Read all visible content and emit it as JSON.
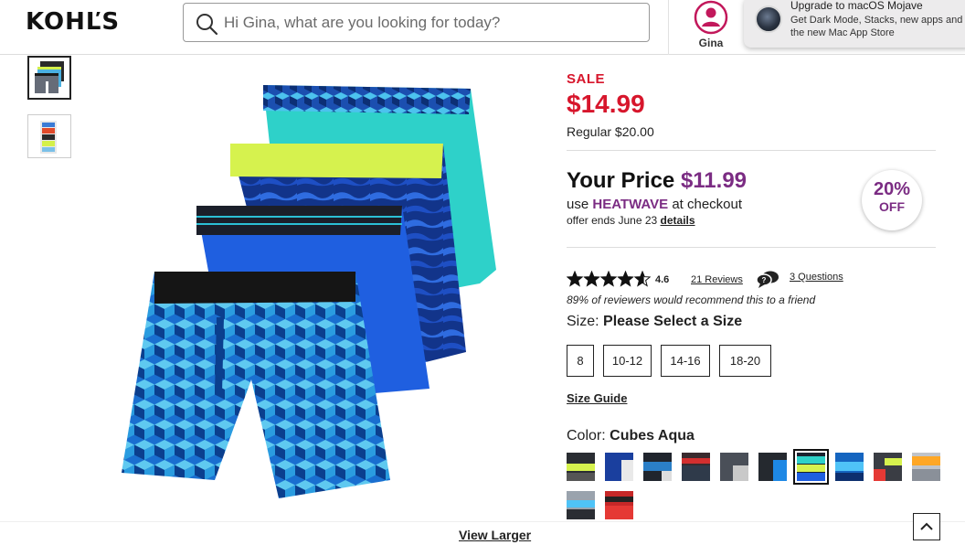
{
  "header": {
    "logo": "KOHĽS",
    "search_placeholder": "Hi Gina, what are you looking for today?",
    "account_name": "Gina"
  },
  "notification": {
    "title": "Upgrade to macOS Mojave",
    "body": "Get Dark Mode, Stacks, new apps and the new Mac App Store"
  },
  "gallery": {
    "view_larger": "View Larger"
  },
  "pricing": {
    "sale_label": "SALE",
    "sale_price": "$14.99",
    "regular": "Regular $20.00",
    "your_price_label": "Your Price",
    "your_price_value": "$11.99",
    "use_prefix": "use",
    "promo_code": "HEATWAVE",
    "use_suffix": "at checkout",
    "offer_text": "offer ends June 23",
    "details_link": "details",
    "badge_percent": "20%",
    "badge_off": "OFF"
  },
  "reviews": {
    "rating": "4.6",
    "rating_fraction": 0.92,
    "reviews_link": "21 Reviews",
    "questions_link": "3 Questions",
    "recommend_text": "89% of reviewers would recommend this to a friend"
  },
  "size": {
    "label": "Size:",
    "prompt": "Please Select a Size",
    "options": [
      "8",
      "10-12",
      "14-16",
      "18-20"
    ],
    "guide_link": "Size Guide"
  },
  "color": {
    "label": "Color:",
    "selected": "Cubes Aqua"
  },
  "colors": {
    "sale_red": "#d7162c",
    "your_price_purple": "#7b2c83"
  },
  "scroll_top_icon": "chevron-up-icon"
}
